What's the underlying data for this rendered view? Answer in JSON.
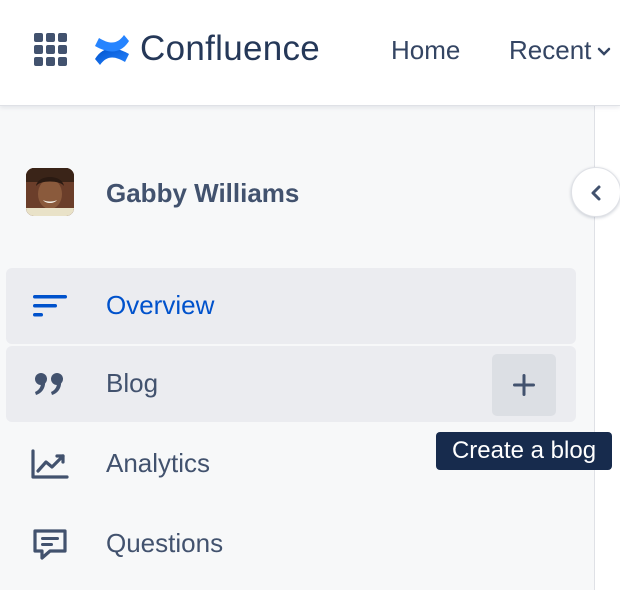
{
  "topnav": {
    "logo_text": "Confluence",
    "items": [
      {
        "label": "Home"
      },
      {
        "label": "Recent"
      }
    ]
  },
  "sidebar": {
    "owner_name": "Gabby Williams",
    "items": [
      {
        "label": "Overview",
        "icon": "overview-lines-icon",
        "selected": true
      },
      {
        "label": "Blog",
        "icon": "quote-icon"
      },
      {
        "label": "Analytics",
        "icon": "analytics-chart-icon"
      },
      {
        "label": "Questions",
        "icon": "chat-bubble-icon"
      }
    ]
  },
  "tooltip": {
    "text": "Create a blog"
  },
  "colors": {
    "brand_blue": "#0052cc",
    "text": "#42526e",
    "sidebar_bg": "#f7f8f9",
    "tooltip_bg": "#172b4d"
  }
}
